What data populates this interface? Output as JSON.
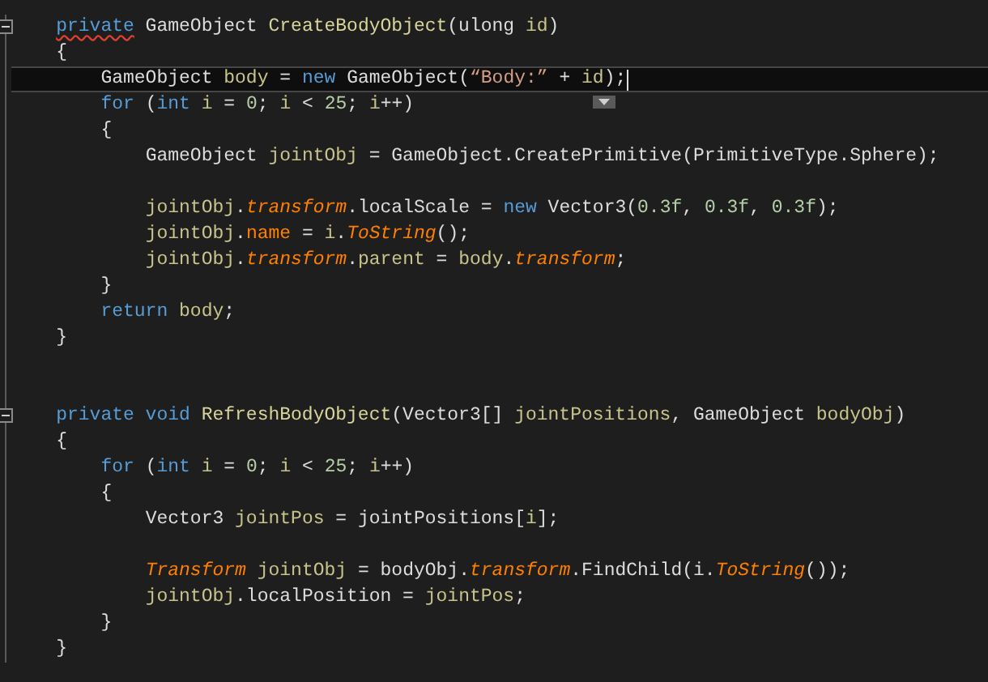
{
  "editor": {
    "lines": [
      {
        "kind": "code",
        "current": false,
        "collapsible": true,
        "tokens": [
          {
            "text": "private",
            "kind": "keyword",
            "squiggle": true
          },
          {
            "text": " GameObject ",
            "kind": "plain"
          },
          {
            "text": "CreateBodyObject",
            "kind": "method"
          },
          {
            "text": "(ulong ",
            "kind": "plain"
          },
          {
            "text": "id",
            "kind": "variable"
          },
          {
            "text": ")",
            "kind": "plain"
          }
        ]
      },
      {
        "kind": "code",
        "current": false,
        "collapsible": false,
        "tokens": [
          {
            "text": "{",
            "kind": "plain"
          }
        ]
      },
      {
        "kind": "code",
        "current": true,
        "collapsible": false,
        "tokens": [
          {
            "text": "GameObject ",
            "kind": "plain"
          },
          {
            "text": "body",
            "kind": "variable"
          },
          {
            "text": " = ",
            "kind": "plain"
          },
          {
            "text": "new",
            "kind": "keyword"
          },
          {
            "text": " GameObject(",
            "kind": "plain"
          },
          {
            "text": "“Body:”",
            "kind": "string"
          },
          {
            "text": " + ",
            "kind": "plain"
          },
          {
            "text": "id",
            "kind": "variable"
          },
          {
            "text": ");",
            "kind": "plain"
          }
        ]
      },
      {
        "kind": "code",
        "current": false,
        "collapsible": false,
        "tokens": [
          {
            "text": "for",
            "kind": "keyword"
          },
          {
            "text": " (",
            "kind": "plain"
          },
          {
            "text": "int ",
            "kind": "keyword"
          },
          {
            "text": "i",
            "kind": "variable"
          },
          {
            "text": " = ",
            "kind": "plain"
          },
          {
            "text": "0",
            "kind": "number"
          },
          {
            "text": "; ",
            "kind": "plain"
          },
          {
            "text": "i",
            "kind": "variable"
          },
          {
            "text": " < ",
            "kind": "plain"
          },
          {
            "text": "25",
            "kind": "number"
          },
          {
            "text": "; ",
            "kind": "plain"
          },
          {
            "text": "i",
            "kind": "variable"
          },
          {
            "text": "++)",
            "kind": "plain"
          }
        ]
      },
      {
        "kind": "code",
        "current": false,
        "collapsible": false,
        "tokens": [
          {
            "text": "{",
            "kind": "plain"
          }
        ]
      },
      {
        "kind": "code",
        "current": false,
        "collapsible": false,
        "tokens": [
          {
            "text": "GameObject ",
            "kind": "plain"
          },
          {
            "text": "jointObj",
            "kind": "variable"
          },
          {
            "text": " = GameObject.CreatePrimitive(PrimitiveType.Sphere);",
            "kind": "plain"
          }
        ]
      },
      {
        "kind": "blank"
      },
      {
        "kind": "code",
        "current": false,
        "collapsible": false,
        "tokens": [
          {
            "text": "jointObj",
            "kind": "variable"
          },
          {
            "text": ".",
            "kind": "plain"
          },
          {
            "text": "transform",
            "kind": "member_italic"
          },
          {
            "text": ".localScale = ",
            "kind": "plain"
          },
          {
            "text": "new",
            "kind": "keyword"
          },
          {
            "text": " Vector3(",
            "kind": "plain"
          },
          {
            "text": "0.3f",
            "kind": "number"
          },
          {
            "text": ", ",
            "kind": "plain"
          },
          {
            "text": "0.3f",
            "kind": "number"
          },
          {
            "text": ", ",
            "kind": "plain"
          },
          {
            "text": "0.3f",
            "kind": "number"
          },
          {
            "text": ");",
            "kind": "plain"
          }
        ]
      },
      {
        "kind": "code",
        "current": false,
        "collapsible": false,
        "tokens": [
          {
            "text": "jointObj",
            "kind": "variable"
          },
          {
            "text": ".",
            "kind": "plain"
          },
          {
            "text": "name",
            "kind": "member"
          },
          {
            "text": " = ",
            "kind": "plain"
          },
          {
            "text": "i",
            "kind": "variable"
          },
          {
            "text": ".",
            "kind": "plain"
          },
          {
            "text": "ToString",
            "kind": "member_italic"
          },
          {
            "text": "();",
            "kind": "plain"
          }
        ]
      },
      {
        "kind": "code",
        "current": false,
        "collapsible": false,
        "tokens": [
          {
            "text": "jointObj",
            "kind": "variable"
          },
          {
            "text": ".",
            "kind": "plain"
          },
          {
            "text": "transform",
            "kind": "member_italic"
          },
          {
            "text": ".",
            "kind": "plain"
          },
          {
            "text": "parent",
            "kind": "variable"
          },
          {
            "text": " = ",
            "kind": "plain"
          },
          {
            "text": "body",
            "kind": "variable"
          },
          {
            "text": ".",
            "kind": "plain"
          },
          {
            "text": "transform",
            "kind": "member_italic"
          },
          {
            "text": ";",
            "kind": "plain"
          }
        ]
      },
      {
        "kind": "code",
        "current": false,
        "collapsible": false,
        "tokens": [
          {
            "text": "}",
            "kind": "plain"
          }
        ]
      },
      {
        "kind": "code",
        "current": false,
        "collapsible": false,
        "tokens": [
          {
            "text": "return ",
            "kind": "keyword"
          },
          {
            "text": "body",
            "kind": "variable"
          },
          {
            "text": ";",
            "kind": "plain"
          }
        ]
      },
      {
        "kind": "code",
        "current": false,
        "collapsible": false,
        "tokens": [
          {
            "text": "}",
            "kind": "plain"
          }
        ]
      },
      {
        "kind": "blank"
      },
      {
        "kind": "blank"
      },
      {
        "kind": "code",
        "current": false,
        "collapsible": true,
        "tokens": [
          {
            "text": "private void ",
            "kind": "keyword"
          },
          {
            "text": "RefreshBodyObject",
            "kind": "method"
          },
          {
            "text": "(Vector3[] ",
            "kind": "plain"
          },
          {
            "text": "jointPositions",
            "kind": "variable"
          },
          {
            "text": ", GameObject ",
            "kind": "plain"
          },
          {
            "text": "bodyObj",
            "kind": "variable"
          },
          {
            "text": ")",
            "kind": "plain"
          }
        ]
      },
      {
        "kind": "code",
        "current": false,
        "collapsible": false,
        "tokens": [
          {
            "text": "{",
            "kind": "plain"
          }
        ]
      },
      {
        "kind": "code",
        "current": false,
        "collapsible": false,
        "tokens": [
          {
            "text": "for",
            "kind": "keyword"
          },
          {
            "text": " (",
            "kind": "plain"
          },
          {
            "text": "int ",
            "kind": "keyword"
          },
          {
            "text": "i",
            "kind": "variable"
          },
          {
            "text": " = ",
            "kind": "plain"
          },
          {
            "text": "0",
            "kind": "number"
          },
          {
            "text": "; ",
            "kind": "plain"
          },
          {
            "text": "i",
            "kind": "variable"
          },
          {
            "text": " < ",
            "kind": "plain"
          },
          {
            "text": "25",
            "kind": "number"
          },
          {
            "text": "; ",
            "kind": "plain"
          },
          {
            "text": "i",
            "kind": "variable"
          },
          {
            "text": "++)",
            "kind": "plain"
          }
        ]
      },
      {
        "kind": "code",
        "current": false,
        "collapsible": false,
        "tokens": [
          {
            "text": "{",
            "kind": "plain"
          }
        ]
      },
      {
        "kind": "code",
        "current": false,
        "collapsible": false,
        "tokens": [
          {
            "text": "Vector3 ",
            "kind": "plain"
          },
          {
            "text": "jointPos",
            "kind": "variable"
          },
          {
            "text": " = jointPositions[",
            "kind": "plain"
          },
          {
            "text": "i",
            "kind": "variable"
          },
          {
            "text": "];",
            "kind": "plain"
          }
        ]
      },
      {
        "kind": "blank"
      },
      {
        "kind": "code",
        "current": false,
        "collapsible": false,
        "tokens": [
          {
            "text": "Transform",
            "kind": "member_italic"
          },
          {
            "text": " jointObj",
            "kind": "variable"
          },
          {
            "text": " = bodyObj.",
            "kind": "plain"
          },
          {
            "text": "transform",
            "kind": "member_italic"
          },
          {
            "text": ".FindChild(i.",
            "kind": "plain"
          },
          {
            "text": "ToString",
            "kind": "member_italic"
          },
          {
            "text": "());",
            "kind": "plain"
          }
        ]
      },
      {
        "kind": "code",
        "current": false,
        "collapsible": false,
        "tokens": [
          {
            "text": "jointObj",
            "kind": "variable"
          },
          {
            "text": ".localPosition = ",
            "kind": "plain"
          },
          {
            "text": "jointPos",
            "kind": "variable"
          },
          {
            "text": ";",
            "kind": "plain"
          }
        ]
      },
      {
        "kind": "code",
        "current": false,
        "collapsible": false,
        "tokens": [
          {
            "text": "}",
            "kind": "plain"
          }
        ]
      },
      {
        "kind": "code",
        "current": false,
        "collapsible": false,
        "tokens": [
          {
            "text": "}",
            "kind": "plain"
          }
        ]
      }
    ]
  }
}
